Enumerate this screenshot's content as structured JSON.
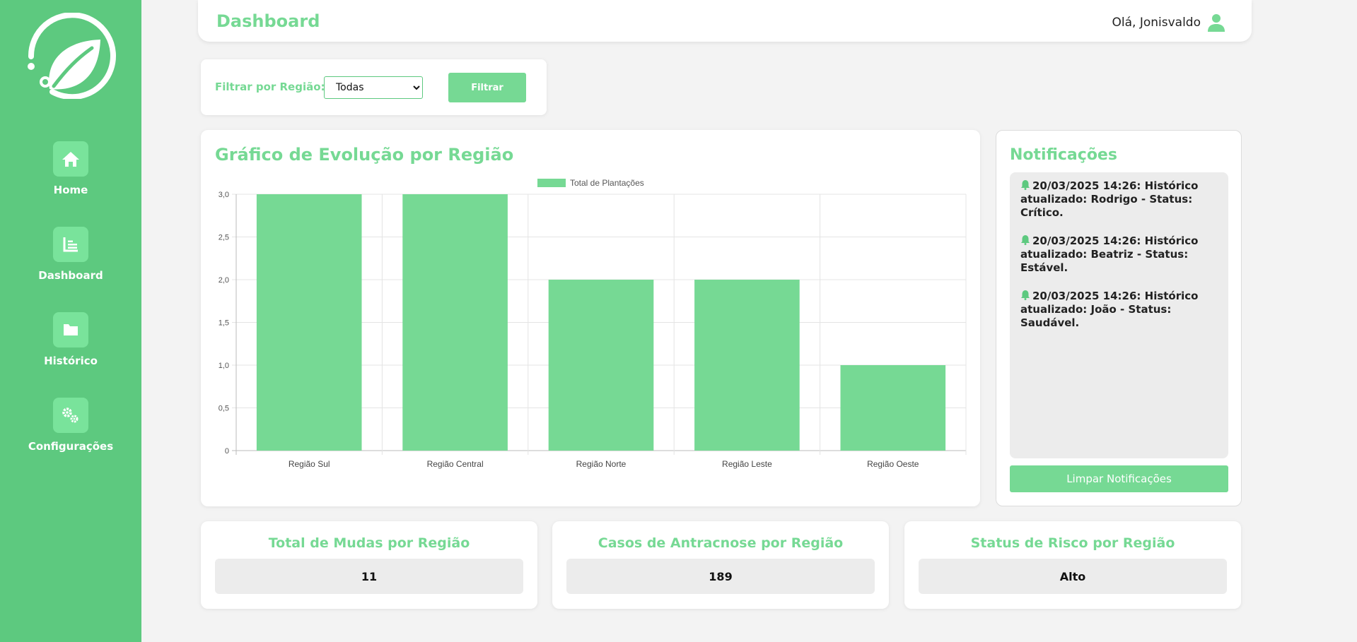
{
  "header": {
    "title": "Dashboard",
    "greeting": "Olá, Jonisvaldo"
  },
  "sidebar": {
    "items": [
      {
        "label": "Home",
        "icon": "home-icon"
      },
      {
        "label": "Dashboard",
        "icon": "chart-icon"
      },
      {
        "label": "Histórico",
        "icon": "folder-icon"
      },
      {
        "label": "Configurações",
        "icon": "gears-icon"
      }
    ]
  },
  "filter": {
    "label": "Filtrar por Região:",
    "selected": "Todas",
    "button_label": "Filtrar"
  },
  "chart": {
    "title": "Gráfico de Evolução por Região"
  },
  "chart_data": {
    "type": "bar",
    "categories": [
      "Região Sul",
      "Região Central",
      "Região Norte",
      "Região Leste",
      "Região Oeste"
    ],
    "series": [
      {
        "name": "Total de Plantações",
        "values": [
          3,
          3,
          2,
          2,
          1
        ]
      }
    ],
    "ylim": [
      0,
      3
    ],
    "yticks": [
      "0",
      "0,5",
      "1,0",
      "1,5",
      "2,0",
      "2,5",
      "3,0"
    ],
    "legend_position": "top-center",
    "grid": true,
    "color": "#76d994"
  },
  "notifications": {
    "title": "Notificações",
    "items": [
      "20/03/2025 14:26: Histórico atualizado: Rodrigo - Status: Crítico.",
      "20/03/2025 14:26: Histórico atualizado: Beatriz - Status: Estável.",
      "20/03/2025 14:26: Histórico atualizado: João - Status: Saudável."
    ],
    "clear_label": "Limpar Notificações"
  },
  "stats": [
    {
      "title": "Total de Mudas por Região",
      "value": "11"
    },
    {
      "title": "Casos de Antracnose por Região",
      "value": "189"
    },
    {
      "title": "Status de Risco por Região",
      "value": "Alto"
    }
  ],
  "colors": {
    "sidebar": "#5dc97f",
    "accent": "#76d994",
    "nav_tile": "#79e39b"
  }
}
